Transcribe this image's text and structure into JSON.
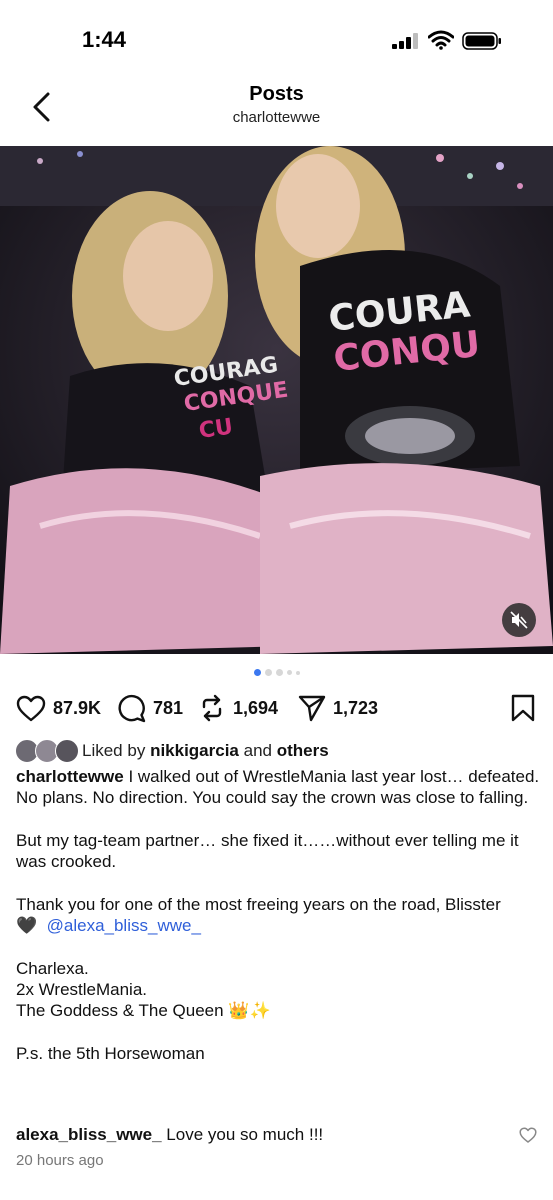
{
  "status": {
    "time": "1:44"
  },
  "nav": {
    "title": "Posts",
    "username": "charlottewwe"
  },
  "post": {
    "image_description_icons": [
      "speaker-muted-icon"
    ],
    "carousel": {
      "count": 5,
      "active": 0
    }
  },
  "actions": {
    "likes": "87.9K",
    "comments": "781",
    "reposts": "1,694",
    "shares": "1,723"
  },
  "liked_by": {
    "prefix": "Liked by",
    "user": "nikkigarcia",
    "joiner": "and",
    "others": "others"
  },
  "caption": {
    "username": "charlottewwe",
    "line1": "I walked out of WrestleMania last year lost… defeated.",
    "line2": "No plans. No direction. You could say the crown was close to falling.",
    "line3": "But my tag-team partner… she fixed it……without ever telling me it was crooked.",
    "line4": "Thank you for one of the most freeing years on the road, Blisster",
    "heart": "🖤",
    "mention": "@alexa_bliss_wwe_",
    "line5": "Charlexa.",
    "line6": "2x WrestleMania.",
    "line7": "The Goddess & The Queen",
    "emoji": "👑✨",
    "line8": "P.s. the 5th Horsewoman"
  },
  "comment": {
    "username": "alexa_bliss_wwe_",
    "text": "Love you so much !!!"
  },
  "time_ago": "20 hours ago",
  "colors": {
    "accent": "#3b78f0",
    "mention": "#2f5fd9",
    "muted": "#777777"
  }
}
